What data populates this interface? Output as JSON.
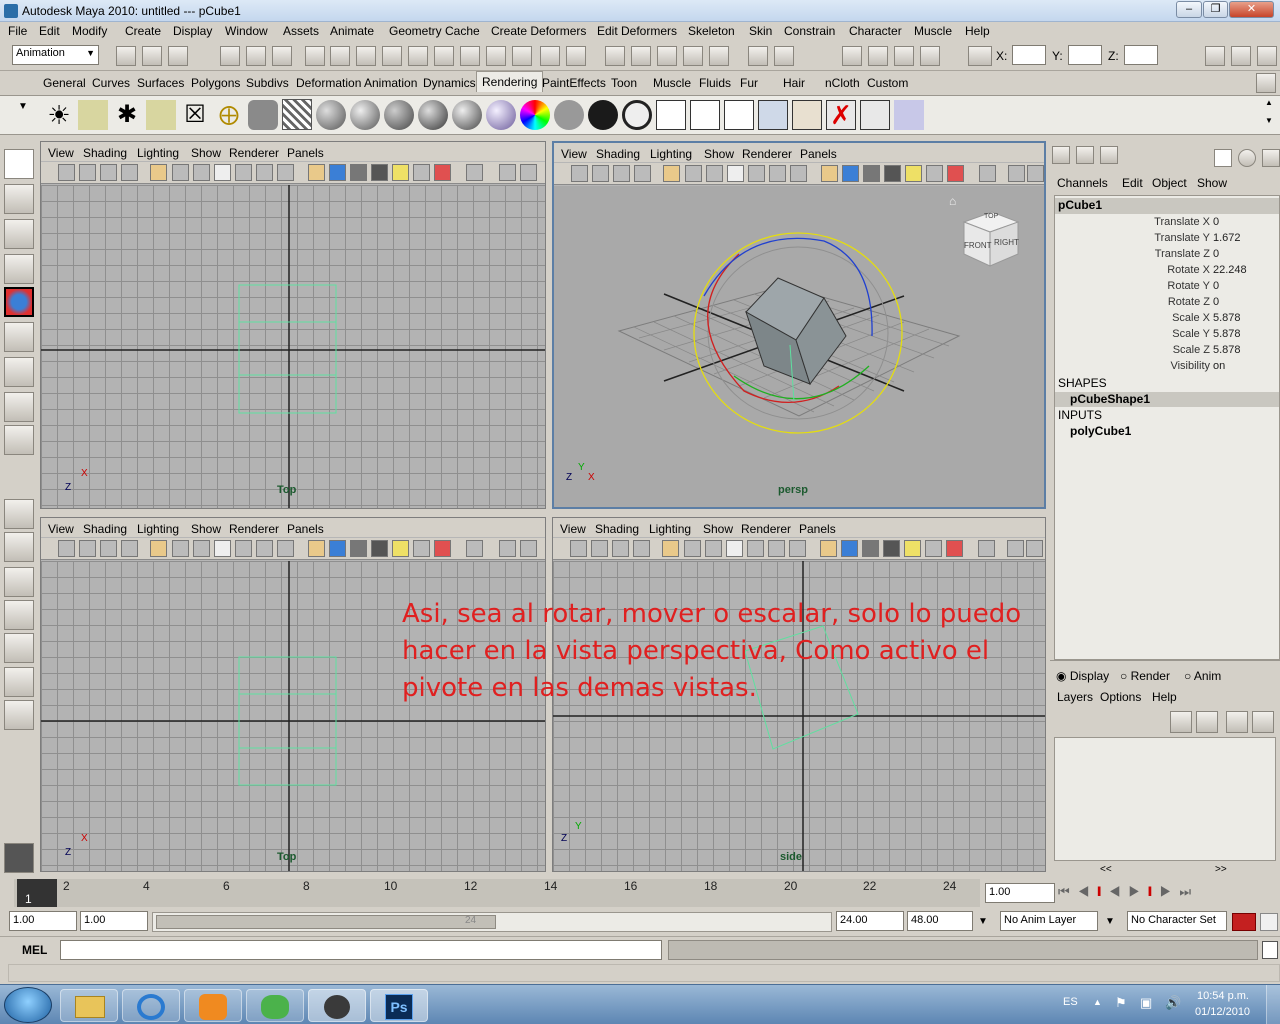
{
  "window": {
    "title": "Autodesk Maya 2010: untitled   ---   pCube1"
  },
  "menubar": [
    "File",
    "Edit",
    "Modify",
    "Create",
    "Display",
    "Window",
    "Assets",
    "Animate",
    "Geometry Cache",
    "Create Deformers",
    "Edit Deformers",
    "Skeleton",
    "Skin",
    "Constrain",
    "Character",
    "Muscle",
    "Help"
  ],
  "statusline": {
    "menuset": "Animation",
    "x_label": "X:",
    "y_label": "Y:",
    "z_label": "Z:"
  },
  "shelf_tabs": [
    "General",
    "Curves",
    "Surfaces",
    "Polygons",
    "Subdivs",
    "Deformation",
    "Animation",
    "Dynamics",
    "Rendering",
    "PaintEffects",
    "Toon",
    "Muscle",
    "Fluids",
    "Fur",
    "Hair",
    "nCloth",
    "Custom"
  ],
  "shelf_active": "Rendering",
  "panel_menu": [
    "View",
    "Shading",
    "Lighting",
    "Show",
    "Renderer",
    "Panels"
  ],
  "viewports": {
    "tl": "Top",
    "tr": "persp",
    "bl": "Top",
    "br": "side"
  },
  "viewcube": {
    "top": "TOP",
    "front": "FRONT",
    "right": "RIGHT"
  },
  "axis": {
    "x": "X",
    "y": "Y",
    "z": "Z"
  },
  "channel_box": {
    "menu": [
      "Channels",
      "Edit",
      "Object",
      "Show"
    ],
    "object": "pCube1",
    "attrs": [
      {
        "name": "Translate X",
        "value": "0"
      },
      {
        "name": "Translate Y",
        "value": "1.672"
      },
      {
        "name": "Translate Z",
        "value": "0"
      },
      {
        "name": "Rotate X",
        "value": "22.248"
      },
      {
        "name": "Rotate Y",
        "value": "0"
      },
      {
        "name": "Rotate Z",
        "value": "0"
      },
      {
        "name": "Scale X",
        "value": "5.878"
      },
      {
        "name": "Scale Y",
        "value": "5.878"
      },
      {
        "name": "Scale Z",
        "value": "5.878"
      },
      {
        "name": "Visibility",
        "value": "on"
      }
    ],
    "shapes_label": "SHAPES",
    "shape": "pCubeShape1",
    "inputs_label": "INPUTS",
    "input": "polyCube1"
  },
  "layer_editor": {
    "radios": [
      "Display",
      "Render",
      "Anim"
    ],
    "menu": [
      "Layers",
      "Options",
      "Help"
    ],
    "scroll_left": "<<",
    "scroll_right": ">>"
  },
  "timeline": {
    "current_frame": "1",
    "ticks": [
      "2",
      "4",
      "6",
      "8",
      "10",
      "12",
      "14",
      "16",
      "18",
      "20",
      "22",
      "24"
    ],
    "current_time": "1.00"
  },
  "range": {
    "start": "1.00",
    "playback_start": "1.00",
    "slider_label": "24",
    "playback_end": "24.00",
    "end": "48.00",
    "anim_layer": "No Anim Layer",
    "character_set": "No Character Set"
  },
  "command_line": {
    "label": "MEL"
  },
  "overlay": {
    "line1": "Asi, sea al rotar, mover  o escalar, solo lo puedo",
    "line2": "hacer en la vista perspectiva, Como activo el",
    "line3": "pivote en las demas vistas."
  },
  "taskbar": {
    "lang": "ES",
    "time": "10:54 p.m.",
    "date": "01/12/2010",
    "ps_label": "Ps"
  }
}
